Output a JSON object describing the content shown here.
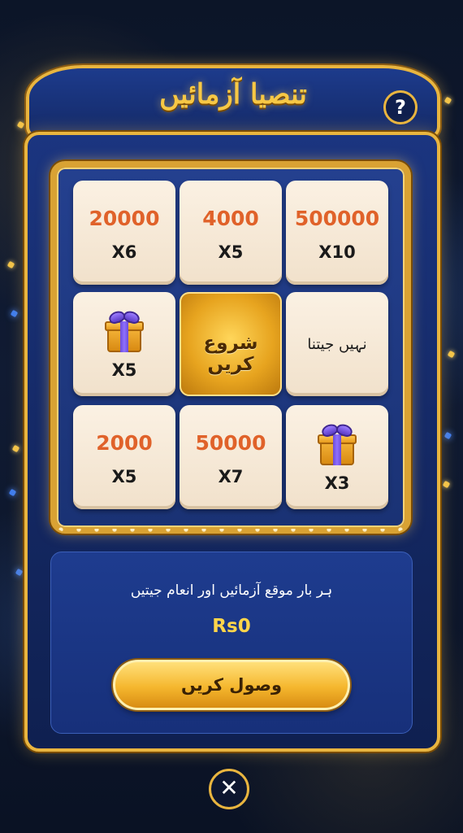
{
  "header": {
    "title": "تنصیا آزمائیں",
    "help_label": "?"
  },
  "grid": {
    "tiles": [
      {
        "amount": "20000",
        "multiplier": "X6"
      },
      {
        "amount": "4000",
        "multiplier": "X5"
      },
      {
        "amount": "500000",
        "multiplier": "X10"
      },
      {
        "icon": "gift-icon",
        "multiplier": "X5"
      },
      {
        "start_label": "شروع کریں"
      },
      {
        "label": "نہیں جیتنا"
      },
      {
        "amount": "2000",
        "multiplier": "X5"
      },
      {
        "amount": "50000",
        "multiplier": "X7"
      },
      {
        "icon": "gift-icon",
        "multiplier": "X3"
      }
    ]
  },
  "reward": {
    "message": "ہر بار موقع آزمائیں اور انعام جیتیں",
    "balance": "Rs0",
    "claim_label": "وصول کریں"
  },
  "close_label": "✕",
  "colors": {
    "gold": "#e9b53f",
    "panel_blue": "#1b3580",
    "amount_orange": "#e0622a",
    "balance_yellow": "#ffd54a"
  }
}
